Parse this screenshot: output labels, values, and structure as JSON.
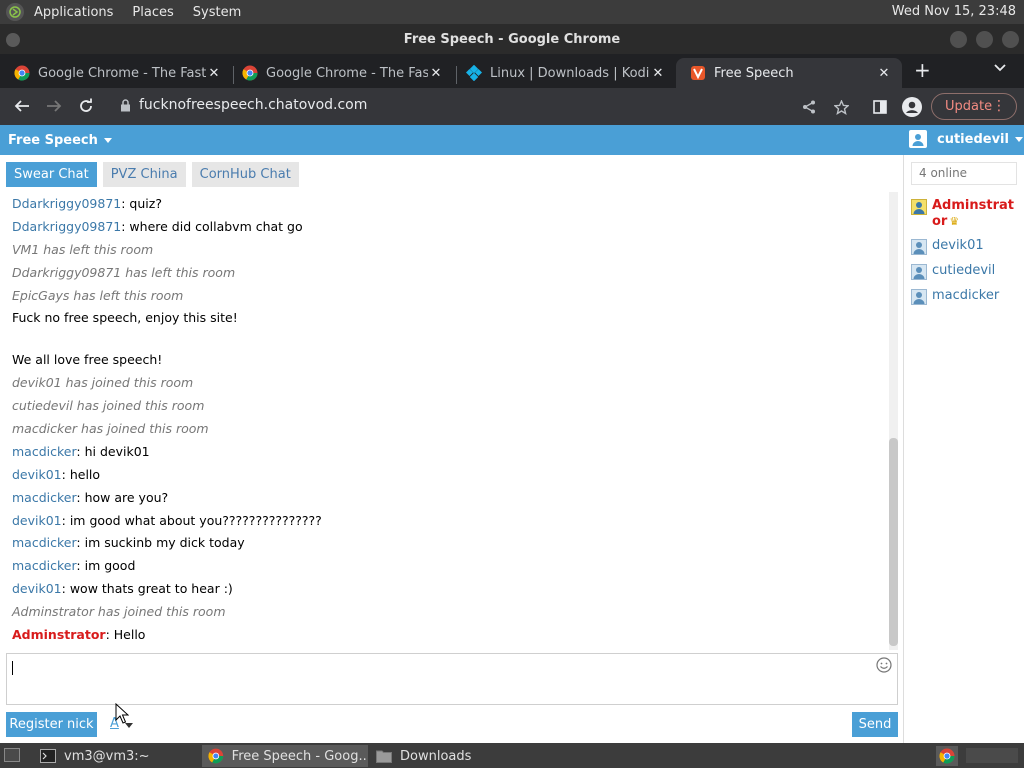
{
  "top_panel": {
    "menus": [
      "Applications",
      "Places",
      "System"
    ],
    "clock": "Wed Nov 15, 23:48"
  },
  "window": {
    "title": "Free Speech - Google Chrome"
  },
  "tabs": [
    {
      "label": "Google Chrome - The Fast &",
      "favicon": "chrome-icon"
    },
    {
      "label": "Google Chrome - The Fast &",
      "favicon": "chrome-icon"
    },
    {
      "label": "Linux | Downloads | Kodi",
      "favicon": "kodi-icon"
    },
    {
      "label": "Free Speech",
      "favicon": "chatovod-icon",
      "active": true
    }
  ],
  "toolbar": {
    "url": "fucknofreespeech.chatovod.com",
    "update_label": "Update"
  },
  "site": {
    "brand": "Free Speech",
    "username": "cutiedevil",
    "accent": "#4a9fd6"
  },
  "rooms": [
    "Swear Chat",
    "PVZ China",
    "CornHub Chat"
  ],
  "messages": [
    {
      "type": "chat",
      "nick": "Ddarkriggy09871",
      "text": ": quiz?"
    },
    {
      "type": "chat",
      "nick": "Ddarkriggy09871",
      "text": ": where did collabvm chat go"
    },
    {
      "type": "sys",
      "text": "VM1 has left this room"
    },
    {
      "type": "sys",
      "text": "Ddarkriggy09871 has left this room"
    },
    {
      "type": "sys",
      "text": "EpicGays has left this room"
    },
    {
      "type": "plain",
      "text": "Fuck no free speech, enjoy this site!"
    },
    {
      "type": "blank",
      "text": ""
    },
    {
      "type": "plain",
      "text": "We all love free speech!"
    },
    {
      "type": "sys",
      "text": "devik01 has joined this room"
    },
    {
      "type": "sys",
      "text": "cutiedevil has joined this room"
    },
    {
      "type": "sys",
      "text": "macdicker has joined this room"
    },
    {
      "type": "chat",
      "nick": "macdicker",
      "text": ": hi devik01"
    },
    {
      "type": "chat",
      "nick": "devik01",
      "text": ": hello"
    },
    {
      "type": "chat",
      "nick": "macdicker",
      "text": ": how are you?"
    },
    {
      "type": "chat",
      "nick": "devik01",
      "text": ": im good what about you???????????????"
    },
    {
      "type": "chat",
      "nick": "macdicker",
      "text": ": im suckinb my dick today"
    },
    {
      "type": "chat",
      "nick": "macdicker",
      "text": ": im good"
    },
    {
      "type": "chat",
      "nick": "devik01",
      "text": ": wow thats great to hear :)"
    },
    {
      "type": "sys",
      "text": "Adminstrator has joined this room"
    },
    {
      "type": "chat",
      "nick": "Adminstrator",
      "text": ": Hello",
      "admin": true
    }
  ],
  "sidebar": {
    "online_count": "4 online",
    "users": [
      {
        "name": "Adminstrator",
        "admin": true
      },
      {
        "name": "devik01"
      },
      {
        "name": "cutiedevil"
      },
      {
        "name": "macdicker"
      }
    ]
  },
  "composer": {
    "value": "",
    "register_label": "Register nick",
    "font_label": "A",
    "send_label": "Send"
  },
  "taskbar": {
    "items": [
      {
        "label": "vm3@vm3:~",
        "icon": "terminal-icon"
      },
      {
        "label": "Free Speech - Goog...",
        "icon": "chrome-icon",
        "active": true
      },
      {
        "label": "Downloads",
        "icon": "folder-icon"
      }
    ]
  }
}
